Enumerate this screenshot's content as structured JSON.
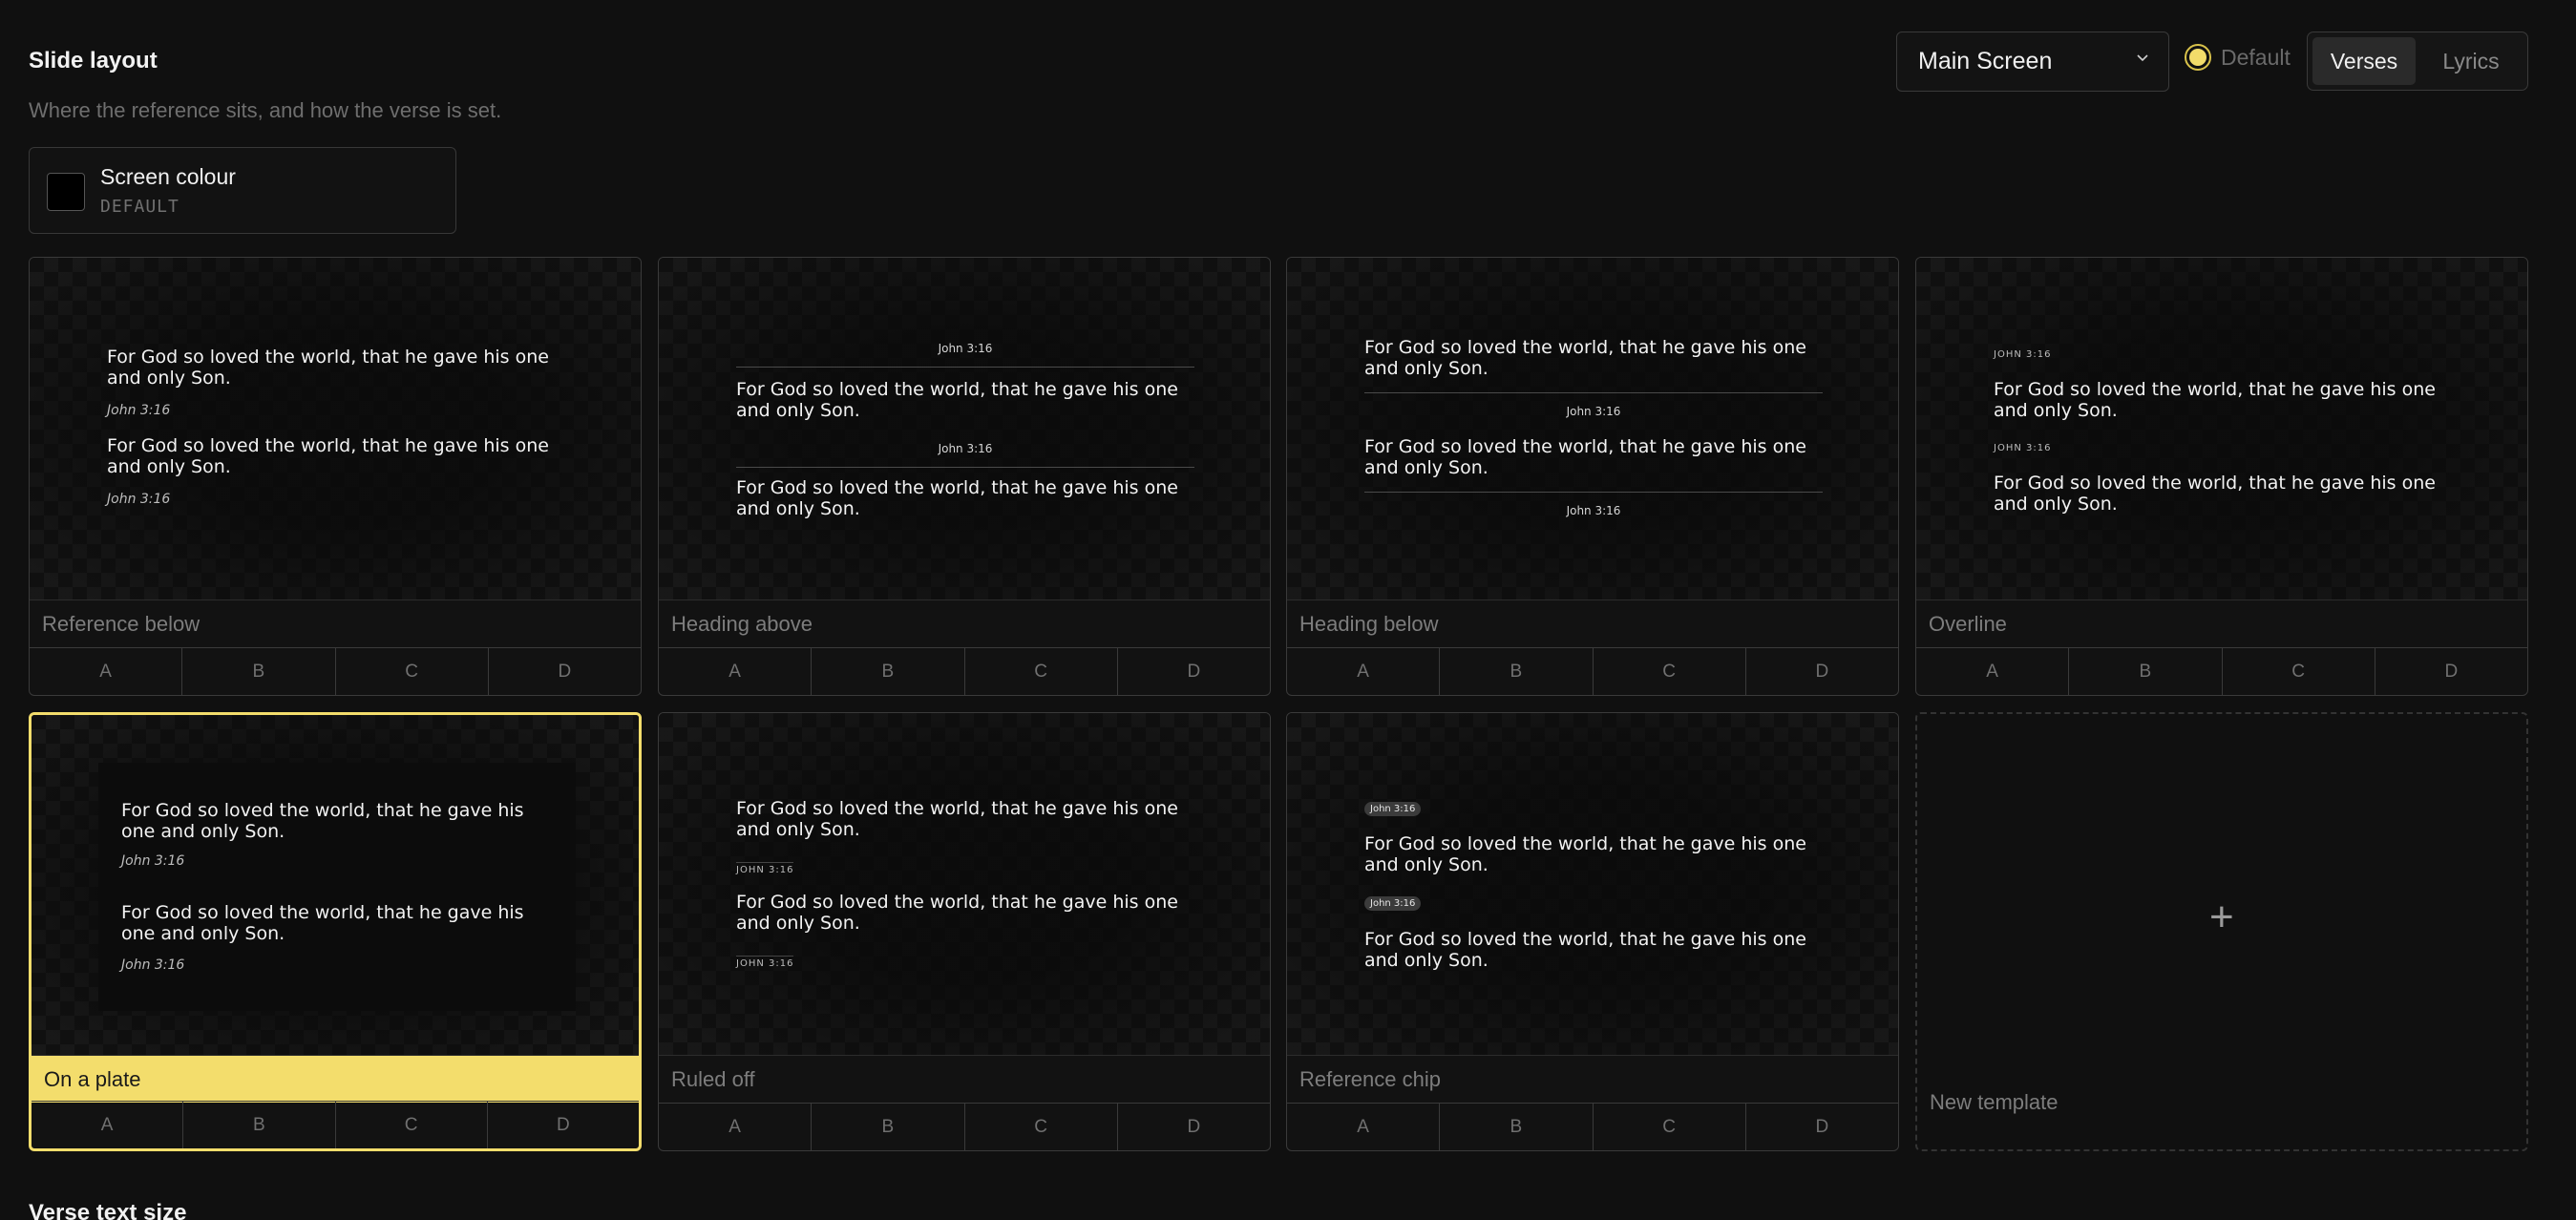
{
  "header": {
    "title": "Slide layout",
    "subtitle": "Where the reference sits, and how the verse is set."
  },
  "screen_select": {
    "value": "Main Screen"
  },
  "default_toggle": {
    "label": "Default"
  },
  "mode_tabs": [
    {
      "label": "Verses",
      "active": true
    },
    {
      "label": "Lyrics",
      "active": false
    }
  ],
  "screen_colour": {
    "label": "Screen colour",
    "value": "DEFAULT"
  },
  "preview": {
    "verse": "For God so loved the world, that he gave his one and only Son.",
    "reference": "John 3:16",
    "reference_upper": "JOHN 3:16"
  },
  "templates": [
    {
      "name": "Reference below",
      "selected": false
    },
    {
      "name": "Heading above",
      "selected": false
    },
    {
      "name": "Heading below",
      "selected": false
    },
    {
      "name": "Overline",
      "selected": false
    },
    {
      "name": "On a plate",
      "selected": true
    },
    {
      "name": "Ruled off",
      "selected": false
    },
    {
      "name": "Reference chip",
      "selected": false
    }
  ],
  "variants": [
    "A",
    "B",
    "C",
    "D"
  ],
  "new_template": {
    "plus": "+",
    "label": "New template"
  },
  "next_section": {
    "title": "Verse text size"
  },
  "colors": {
    "accent": "#f3dd6c",
    "background": "#101010"
  }
}
